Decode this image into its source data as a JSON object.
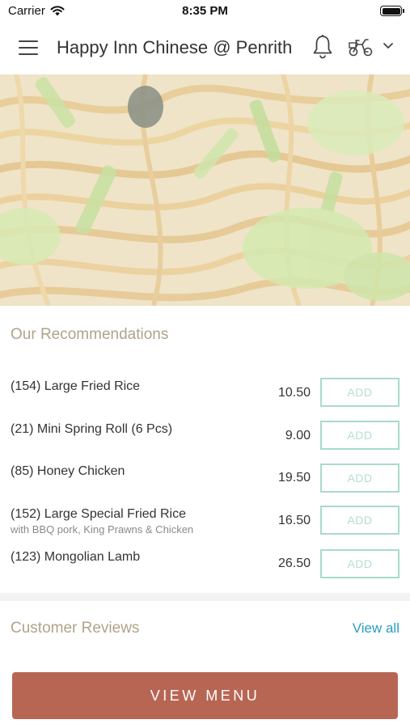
{
  "status_bar": {
    "carrier": "Carrier",
    "time": "8:35 PM"
  },
  "header": {
    "title": "Happy Inn Chinese @ Penrith",
    "icons": [
      "menu-icon",
      "bell-icon",
      "delivery-bike-icon",
      "chevron-down-icon"
    ]
  },
  "hero": {
    "image": "stir-fried noodles with spring onion and lettuce"
  },
  "recommendations": {
    "title": "Our Recommendations",
    "add_label": "ADD",
    "items": [
      {
        "name": "(154) Large Fried Rice",
        "description": "",
        "price": "10.50"
      },
      {
        "name": "(21) Mini Spring Roll (6 Pcs)",
        "description": "",
        "price": "9.00"
      },
      {
        "name": "(85) Honey Chicken",
        "description": "",
        "price": "19.50"
      },
      {
        "name": "(152) Large Special Fried Rice",
        "description": "with BBQ pork, King Prawns & Chicken",
        "price": "16.50"
      },
      {
        "name": "(123) Mongolian Lamb",
        "description": "",
        "price": "26.50"
      }
    ]
  },
  "reviews": {
    "title": "Customer Reviews",
    "view_all": "View all"
  },
  "footer": {
    "view_menu": "VIEW MENU"
  },
  "colors": {
    "accent_button": "#b86654",
    "add_border": "#a8dcc8",
    "section_title": "#b0a38a",
    "link": "#2a9bc4"
  }
}
